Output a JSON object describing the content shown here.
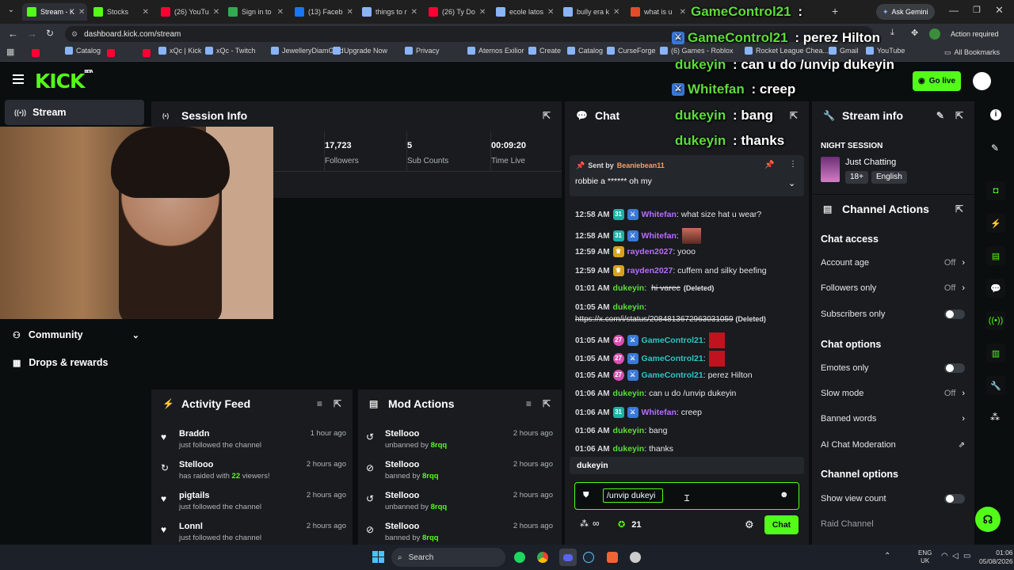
{
  "browser": {
    "tabs": [
      {
        "title": "Stream - K",
        "color": "#53fc18",
        "active": true
      },
      {
        "title": "Stocks",
        "color": "#53fc18"
      },
      {
        "title": "(26) YouTu",
        "color": "#ff0033"
      },
      {
        "title": "Sign in to",
        "color": "#34a853"
      },
      {
        "title": "(13) Faceb",
        "color": "#1877f2"
      },
      {
        "title": "things to r",
        "color": "#8ab4f8"
      },
      {
        "title": "(26) Ty Do",
        "color": "#ff0033"
      },
      {
        "title": "ecole latos",
        "color": "#8ab4f8"
      },
      {
        "title": "bully era k",
        "color": "#8ab4f8"
      },
      {
        "title": "what is u",
        "color": "#e34c26"
      }
    ],
    "ask_gemini": "Ask Gemini",
    "url": "dashboard.kick.com/stream",
    "action_required": "Action required",
    "bookmarks": [
      "Catalog",
      "xQc | Kick",
      "xQc - Twitch",
      "JewelleryDiamGold",
      "Upgrade Now",
      "Privacy",
      "Atemos Exilior",
      "Create",
      "Catalog",
      "CurseForge",
      "(6) Games - Roblox",
      "Rocket League Chea...",
      "Gmail",
      "YouTube"
    ],
    "all_bookmarks": "All Bookmarks"
  },
  "header": {
    "logo": "KICK",
    "logo_tag": "BETA",
    "go_live": "Go live"
  },
  "sidebar": {
    "stream": "Stream",
    "community": "Community",
    "drops": "Drops & rewards"
  },
  "session": {
    "title": "Session Info",
    "stats": [
      {
        "value": "17,723",
        "label": "Followers"
      },
      {
        "value": "5",
        "label": "Sub Counts"
      },
      {
        "value": "00:09:20",
        "label": "Time Live"
      }
    ]
  },
  "activity": {
    "title": "Activity Feed",
    "rows": [
      {
        "name": "Braddn",
        "sub": "just followed the channel",
        "ago": "1 hour ago",
        "icon": "heart"
      },
      {
        "name": "Stellooo",
        "sub_pre": "has raided with ",
        "sub_num": "22",
        "sub_post": " viewers!",
        "ago": "2 hours ago",
        "icon": "raid"
      },
      {
        "name": "pigtails",
        "sub": "just followed the channel",
        "ago": "2 hours ago",
        "icon": "heart"
      },
      {
        "name": "Lonnl",
        "sub": "just followed the channel",
        "ago": "2 hours ago",
        "icon": "heart"
      }
    ]
  },
  "mod": {
    "title": "Mod Actions",
    "rows": [
      {
        "name": "Stellooo",
        "action": "unbanned by ",
        "by": "8rqq",
        "ago": "2 hours ago",
        "icon": "unban"
      },
      {
        "name": "Stellooo",
        "action": "banned by ",
        "by": "8rqq",
        "ago": "2 hours ago",
        "icon": "ban"
      },
      {
        "name": "Stellooo",
        "action": "unbanned by ",
        "by": "8rqq",
        "ago": "2 hours ago",
        "icon": "unban"
      },
      {
        "name": "Stellooo",
        "action": "banned by ",
        "by": "8rqq",
        "ago": "2 hours ago",
        "icon": "ban"
      }
    ]
  },
  "chat": {
    "title": "Chat",
    "pinned_by_label": "Sent by",
    "pinned_by": "Beaniebean11",
    "pinned_msg": "robbie a ****** oh my",
    "messages": [
      {
        "time": "12:58 AM",
        "badges": [
          "31",
          "x"
        ],
        "user": "Whitefan",
        "color": "#b86cff",
        "text": ": what size hat u wear?"
      },
      {
        "time": "12:58 AM",
        "badges": [
          "31",
          "x"
        ],
        "user": "Whitefan",
        "color": "#b86cff",
        "text": ":",
        "emote": true
      },
      {
        "time": "12:59 AM",
        "badges": [
          "crown"
        ],
        "user": "rayden2027",
        "color": "#b86cff",
        "text": ": yooo"
      },
      {
        "time": "12:59 AM",
        "badges": [
          "crown"
        ],
        "user": "rayden2027",
        "color": "#b86cff",
        "text": ": cuffem and silky beefing"
      },
      {
        "time": "01:01 AM",
        "badges": [],
        "user": "dukeyin",
        "color": "#5edc3a",
        "text": ": ",
        "struck": "hi varec",
        "deleted": "(Deleted)"
      },
      {
        "time": "01:05 AM",
        "badges": [],
        "user": "dukeyin",
        "color": "#5edc3a",
        "text": ":"
      },
      {
        "time": "01:05 AM",
        "badges": [
          "27",
          "x"
        ],
        "user": "GameControl21",
        "color": "#2ec4c4",
        "text": ":",
        "tag": true
      },
      {
        "time": "01:05 AM",
        "badges": [
          "27",
          "x"
        ],
        "user": "GameControl21",
        "color": "#2ec4c4",
        "text": ":",
        "tag": true
      },
      {
        "time": "01:05 AM",
        "badges": [
          "27",
          "x"
        ],
        "user": "GameControl21",
        "color": "#2ec4c4",
        "text": ": perez Hilton"
      },
      {
        "time": "01:06 AM",
        "badges": [],
        "user": "dukeyin",
        "color": "#5edc3a",
        "text": ": can u do /unvip dukeyin"
      },
      {
        "time": "01:06 AM",
        "badges": [
          "31",
          "x"
        ],
        "user": "Whitefan",
        "color": "#b86cff",
        "text": ": creep"
      },
      {
        "time": "01:06 AM",
        "badges": [],
        "user": "dukeyin",
        "color": "#5edc3a",
        "text": ": bang"
      },
      {
        "time": "01:06 AM",
        "badges": [],
        "user": "dukeyin",
        "color": "#5edc3a",
        "text": ": thanks"
      }
    ],
    "link_text": "https://x.com/i/status/2084813672963031059",
    "link_deleted": "(Deleted)",
    "suggestion": "dukeyin",
    "input_value": "/unvip dukeyi",
    "viewers": "21",
    "send": "Chat"
  },
  "stream_info": {
    "title": "Stream info",
    "stream_title": "NIGHT SESSION",
    "category": "Just Chatting",
    "tags": [
      "18+",
      "English"
    ]
  },
  "channel_actions": {
    "title": "Channel Actions",
    "chat_access": "Chat access",
    "account_age": "Account age",
    "account_age_val": "Off",
    "followers_only": "Followers only",
    "followers_only_val": "Off",
    "subscribers_only": "Subscribers only",
    "chat_options": "Chat options",
    "emotes_only": "Emotes only",
    "slow_mode": "Slow mode",
    "slow_mode_val": "Off",
    "banned_words": "Banned words",
    "ai_mod": "AI Chat Moderation",
    "channel_options": "Channel options",
    "show_view_count": "Show view count",
    "raid_channel": "Raid Channel"
  },
  "overlay": {
    "lines": [
      {
        "name": "GameControl21",
        "text": " : ",
        "icon": false
      },
      {
        "name": "GameControl21",
        "text": " : perez Hilton",
        "icon": true
      },
      {
        "name": "dukeyin",
        "text": " : can u do /unvip dukeyin",
        "icon": false
      },
      {
        "name": "Whitefan",
        "text": " : creep",
        "icon": true
      },
      {
        "name": "dukeyin",
        "text": " : bang",
        "icon": false
      },
      {
        "name": "dukeyin",
        "text": " : thanks",
        "icon": false
      }
    ]
  },
  "taskbar": {
    "search": "Search",
    "lang1": "ENG",
    "lang2": "UK",
    "time": "01:06",
    "date": "05/08/2026"
  }
}
